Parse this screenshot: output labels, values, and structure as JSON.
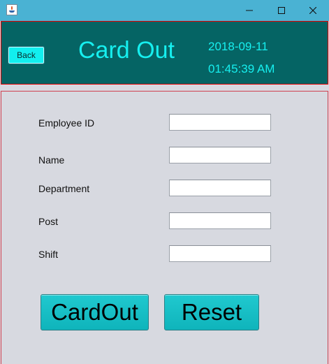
{
  "window": {
    "icon": "java-app-icon",
    "controls": [
      "minimize-icon",
      "maximize-icon",
      "close-icon"
    ]
  },
  "header": {
    "back_label": "Back",
    "title": "Card Out",
    "date": "2018-09-11",
    "time": "01:45:39 AM",
    "colors": {
      "background": "#056464",
      "accent": "#16efef",
      "back_button": "#12efef"
    }
  },
  "form": {
    "fields": [
      {
        "label": "Employee ID",
        "value": ""
      },
      {
        "label": "Name",
        "value": ""
      },
      {
        "label": "Department",
        "value": ""
      },
      {
        "label": "Post",
        "value": ""
      },
      {
        "label": "Shift",
        "value": ""
      }
    ],
    "cardout_label": "CardOut",
    "reset_label": "Reset",
    "colors": {
      "background": "#d7d9e0",
      "button": "#16c0c6"
    }
  }
}
